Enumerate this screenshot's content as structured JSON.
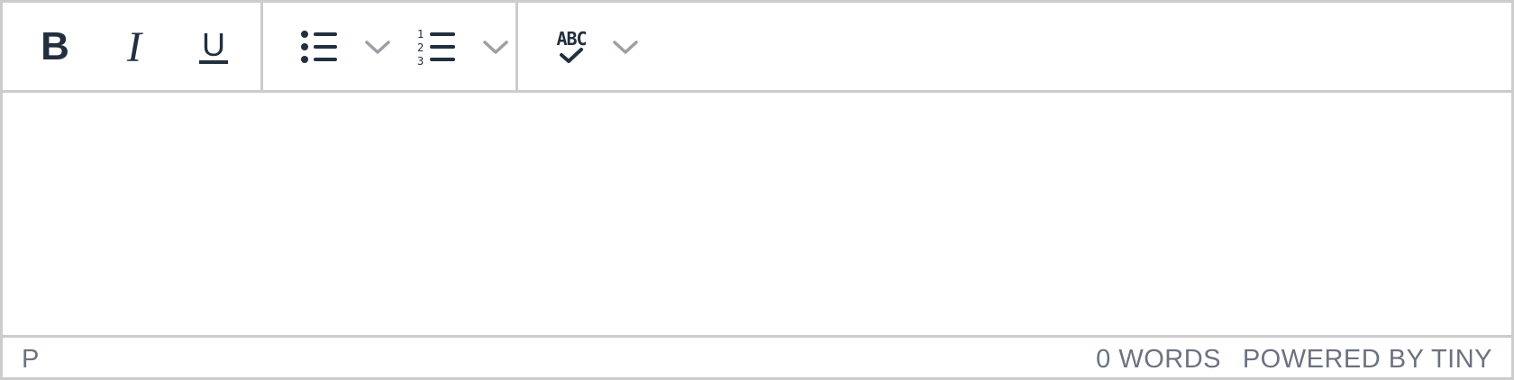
{
  "toolbar": {
    "bold": {
      "icon": "bold-icon",
      "glyph": "B"
    },
    "italic": {
      "icon": "italic-icon",
      "glyph": "I"
    },
    "underline": {
      "icon": "underline-icon",
      "glyph": "U"
    },
    "spellcheck": {
      "icon": "spellcheck-icon",
      "glyph": "ABC"
    }
  },
  "statusbar": {
    "path": "P",
    "word_count": "0 WORDS",
    "brand": "POWERED BY TINY"
  },
  "colors": {
    "border": "#cccccc",
    "icon": "#222f3e",
    "chevron": "#9aa0a6",
    "status_text": "#6b7280"
  }
}
